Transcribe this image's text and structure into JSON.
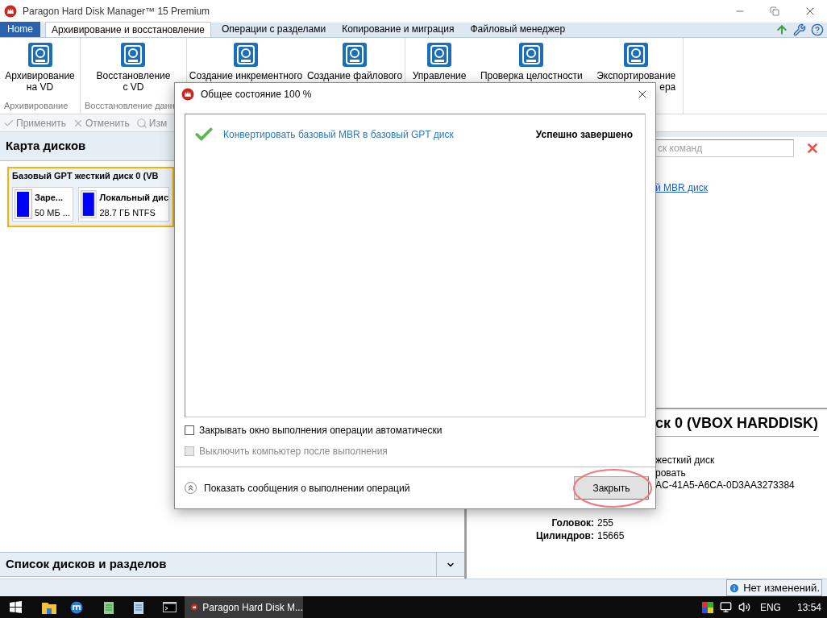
{
  "window": {
    "title": "Paragon Hard Disk Manager™ 15 Premium"
  },
  "tabs": [
    {
      "label": "Home",
      "kind": "home",
      "selected": false
    },
    {
      "label": "Архивирование и восстановление",
      "kind": "tab",
      "selected": true
    },
    {
      "label": "Операции с разделами",
      "kind": "tab",
      "selected": false
    },
    {
      "label": "Копирование и миграция",
      "kind": "tab",
      "selected": false
    },
    {
      "label": "Файловый менеджер",
      "kind": "tab",
      "selected": false
    }
  ],
  "ribbon": {
    "groups": [
      {
        "label": "Архивирование",
        "items": [
          {
            "lines": [
              "Архивирование",
              "на VD"
            ]
          }
        ]
      },
      {
        "label": "Восстановление данн",
        "items": [
          {
            "lines": [
              "Восстановление",
              "с VD"
            ]
          }
        ]
      },
      {
        "items": [
          {
            "lines": [
              "Создание инкрементного"
            ]
          },
          {
            "lines": [
              "Создание файлового"
            ]
          }
        ]
      },
      {
        "items": [
          {
            "lines": [
              "Управление"
            ]
          },
          {
            "lines": [
              "Проверка целостности"
            ]
          },
          {
            "lines": [
              "Экспортирование",
              "ера"
            ]
          }
        ]
      }
    ]
  },
  "toolbar": [
    {
      "label": "Применить",
      "disabled": true
    },
    {
      "label": "Отменить",
      "disabled": true
    },
    {
      "label": "Изм",
      "disabled": true
    }
  ],
  "disk_map": {
    "title": "Карта дисков",
    "disk": {
      "title": "Базовый GPT жесткий диск 0 (VB",
      "partitions": [
        {
          "name": "Заре...",
          "info": "50 МБ ..."
        },
        {
          "name": "Локальный дис",
          "info": "28.7 ГБ NTFS"
        }
      ]
    }
  },
  "disk_list": {
    "title": "Список дисков и разделов"
  },
  "right_panel": {
    "search": {
      "placeholder": "ск команд"
    },
    "link": "й MBR диск",
    "disk_heading": "ск 0 (VBOX HARDDISK)",
    "lines": [
      "жесткий диск",
      "ровать",
      "AC-41A5-A6CA-0D3AA3273384"
    ],
    "properties": [
      {
        "label": "Головок:",
        "value": "255"
      },
      {
        "label": "Цилиндров:",
        "value": "15665"
      }
    ]
  },
  "dialog": {
    "title": "Общее состояние 100 %",
    "operations": [
      {
        "name": "Конвертировать базовый MBR в базовый GPT диск",
        "status": "Успешно завершено",
        "done": true
      }
    ],
    "options": [
      {
        "label": "Закрывать окно выполнения операции автоматически",
        "checked": false,
        "disabled": false
      },
      {
        "label": "Выключить компьютер после выполнения",
        "checked": false,
        "disabled": true
      }
    ],
    "details_toggle": "Показать сообщения о выполнении операций",
    "close_button": "Закрыть"
  },
  "status_bar": {
    "text": "Нет изменений."
  },
  "taskbar": {
    "app": "Paragon Hard Disk M...",
    "language": "ENG",
    "time": "13:54"
  }
}
